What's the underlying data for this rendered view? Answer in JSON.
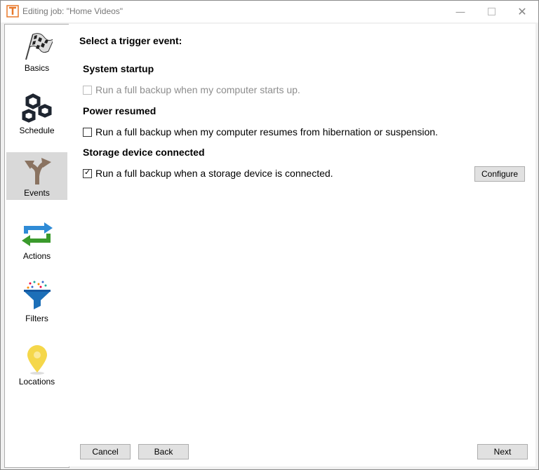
{
  "window": {
    "title": "Editing job: \"Home Videos\""
  },
  "sidebar": {
    "items": [
      {
        "label": "Basics",
        "icon": "checkered-flag-icon"
      },
      {
        "label": "Schedule",
        "icon": "hex-nuts-icon"
      },
      {
        "label": "Events",
        "icon": "branching-arrows-icon",
        "selected": true
      },
      {
        "label": "Actions",
        "icon": "cycle-arrows-icon"
      },
      {
        "label": "Filters",
        "icon": "funnel-icon"
      },
      {
        "label": "Locations",
        "icon": "map-pin-icon"
      }
    ]
  },
  "main": {
    "prompt": "Select a trigger event:",
    "sections": [
      {
        "heading": "System startup",
        "option": "Run a full backup when my computer starts up.",
        "checked": false,
        "disabled": true
      },
      {
        "heading": "Power resumed",
        "option": "Run a full backup when my computer resumes from hibernation or suspension.",
        "checked": false,
        "disabled": false
      },
      {
        "heading": "Storage device connected",
        "option": "Run a full backup when a storage device is connected.",
        "checked": true,
        "disabled": false
      }
    ],
    "configure_label": "Configure"
  },
  "footer": {
    "cancel_label": "Cancel",
    "back_label": "Back",
    "next_label": "Next"
  },
  "colors": {
    "accent_orange": "#e8782a",
    "selected_bg": "#d9d9d9",
    "actions_blue": "#2f8bd6",
    "actions_green": "#3a9a2c",
    "filter_blue": "#1c6fb8",
    "pin_yellow": "#f5d74a"
  }
}
